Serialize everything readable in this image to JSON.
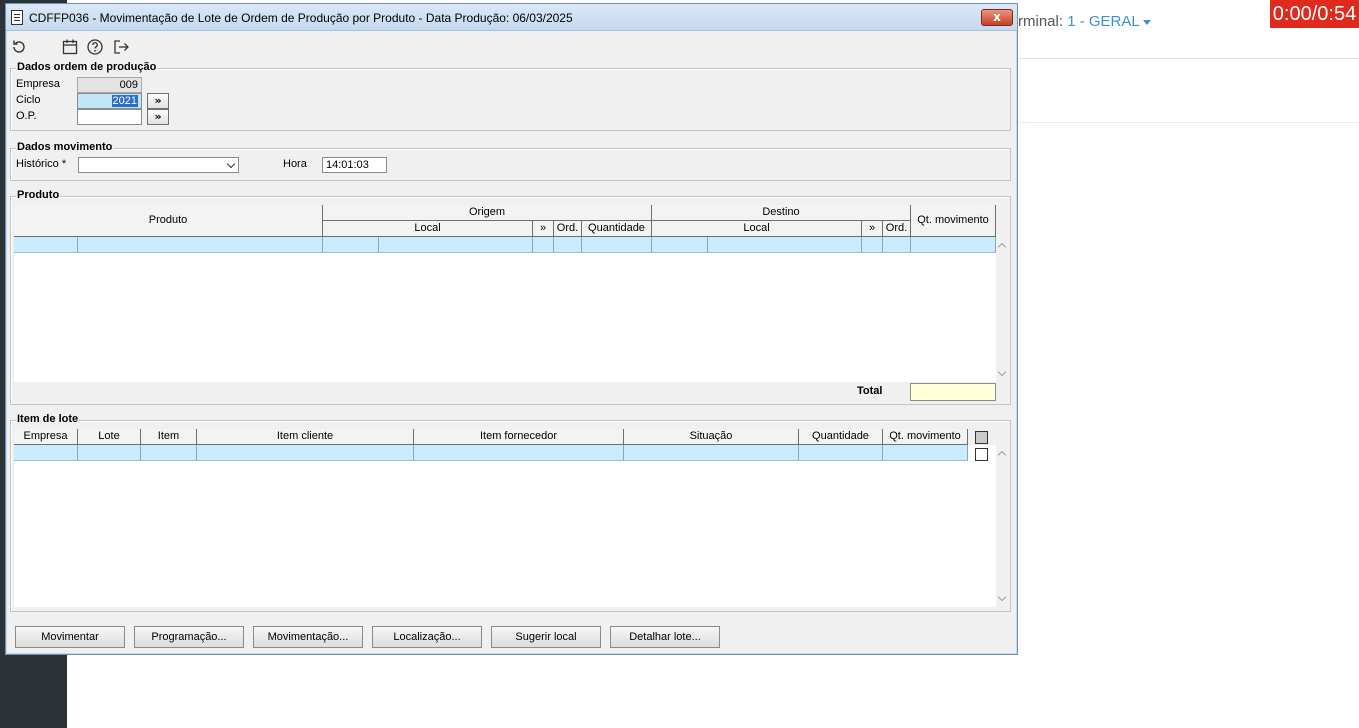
{
  "background": {
    "terminal_prefix": "rminal:",
    "terminal_value": "1 - GERAL",
    "timer": "0:00/0:54"
  },
  "window": {
    "title": "CDFFP036 - Movimentação de Lote de Ordem de Produção por Produto - Data Produção: 06/03/2025",
    "close_label": "x"
  },
  "toolbar": {
    "icons": [
      "refresh-icon",
      "calendar-icon",
      "help-icon",
      "exit-icon"
    ]
  },
  "dados_ordem": {
    "title": "Dados ordem de produção",
    "empresa_label": "Empresa",
    "empresa_value": "009",
    "ciclo_label": "Ciclo",
    "ciclo_value": "2021",
    "op_label": "O.P.",
    "op_value": "",
    "more_button": "»"
  },
  "dados_movimento": {
    "title": "Dados movimento",
    "historico_label": "Histórico *",
    "historico_value": "",
    "hora_label": "Hora",
    "hora_value": "14:01:03"
  },
  "produto": {
    "title": "Produto",
    "headers": {
      "produto": "Produto",
      "origem": "Origem",
      "destino": "Destino",
      "local": "Local",
      "more": "»",
      "ord": "Ord.",
      "quantidade": "Quantidade",
      "qt_movimento": "Qt. movimento"
    },
    "total_label": "Total",
    "total_value": ""
  },
  "item_lote": {
    "title": "Item de lote",
    "headers": [
      "Empresa",
      "Lote",
      "Item",
      "Item cliente",
      "Item fornecedor",
      "Situação",
      "Quantidade",
      "Qt. movimento"
    ]
  },
  "buttons": {
    "movimentar": "Movimentar",
    "programacao": "Programação...",
    "movimentacao": "Movimentação...",
    "localizacao": "Localização...",
    "sugerir_local": "Sugerir local",
    "detalhar_lote": "Detalhar lote..."
  }
}
